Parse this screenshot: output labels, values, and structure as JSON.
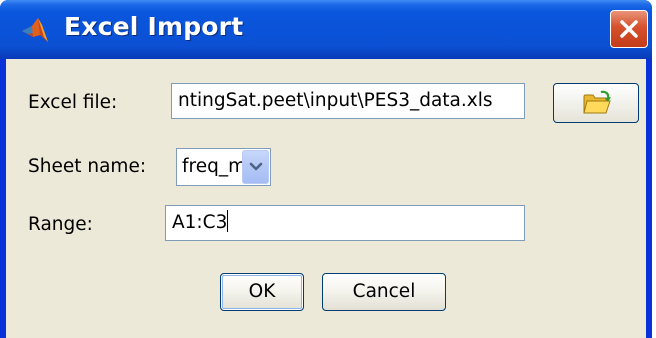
{
  "window": {
    "title": "Excel Import",
    "icon": "matlab-icon",
    "close_icon": "close-icon"
  },
  "form": {
    "excel_file_label": "Excel file:",
    "excel_file_value": "ntingSat.peet\\input\\PES3_data.xls",
    "browse_icon": "open-folder-icon",
    "sheet_name_label": "Sheet name:",
    "sheet_name_value": "freq_mag",
    "range_label": "Range:",
    "range_value": "A1:C3"
  },
  "buttons": {
    "ok_label": "OK",
    "cancel_label": "Cancel"
  },
  "colors": {
    "titlebar": "#0a53d8",
    "client_bg": "#ece9d8",
    "close_button": "#d5502c",
    "input_border": "#7f9db9"
  }
}
